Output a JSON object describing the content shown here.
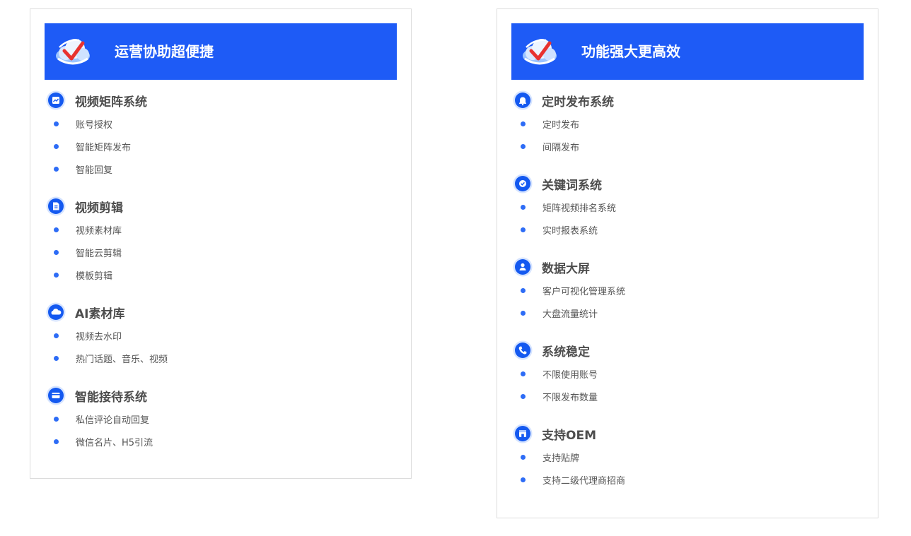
{
  "colors": {
    "banner": "#1e5bf6",
    "icon_blue": "#1459f0",
    "bullet": "#2d6cf6",
    "title_text": "#4d4d4d",
    "item_text": "#555555"
  },
  "left_card": {
    "banner": {
      "title": "运营协助超便捷",
      "logo_icon": "cloud-check-logo-icon"
    },
    "sections": [
      {
        "title": "视频矩阵系统",
        "icon": "chart-icon",
        "items": [
          "账号授权",
          "智能矩阵发布",
          "智能回复"
        ]
      },
      {
        "title": "视频剪辑",
        "icon": "document-icon",
        "items": [
          "视频素材库",
          "智能云剪辑",
          "模板剪辑"
        ]
      },
      {
        "title": "AI素材库",
        "icon": "cloud-icon",
        "items": [
          "视频去水印",
          "热门话题、音乐、视频"
        ]
      },
      {
        "title": "智能接待系统",
        "icon": "card-icon",
        "items": [
          "私信评论自动回复",
          "微信名片、H5引流"
        ]
      }
    ]
  },
  "right_card": {
    "banner": {
      "title": "功能强大更高效",
      "logo_icon": "cloud-check-logo-icon"
    },
    "sections": [
      {
        "title": "定时发布系统",
        "icon": "bell-icon",
        "items": [
          "定时发布",
          "间隔发布"
        ]
      },
      {
        "title": "关键词系统",
        "icon": "check-circle-icon",
        "items": [
          "矩阵视频排名系统",
          "实时报表系统"
        ]
      },
      {
        "title": "数据大屏",
        "icon": "user-icon",
        "items": [
          "客户可视化管理系统",
          "大盘流量统计"
        ]
      },
      {
        "title": "系统稳定",
        "icon": "phone-icon",
        "items": [
          "不限使用账号",
          "不限发布数量"
        ]
      },
      {
        "title": "支持OEM",
        "icon": "store-icon",
        "items": [
          "支持贴牌",
          "支持二级代理商招商"
        ]
      }
    ]
  }
}
